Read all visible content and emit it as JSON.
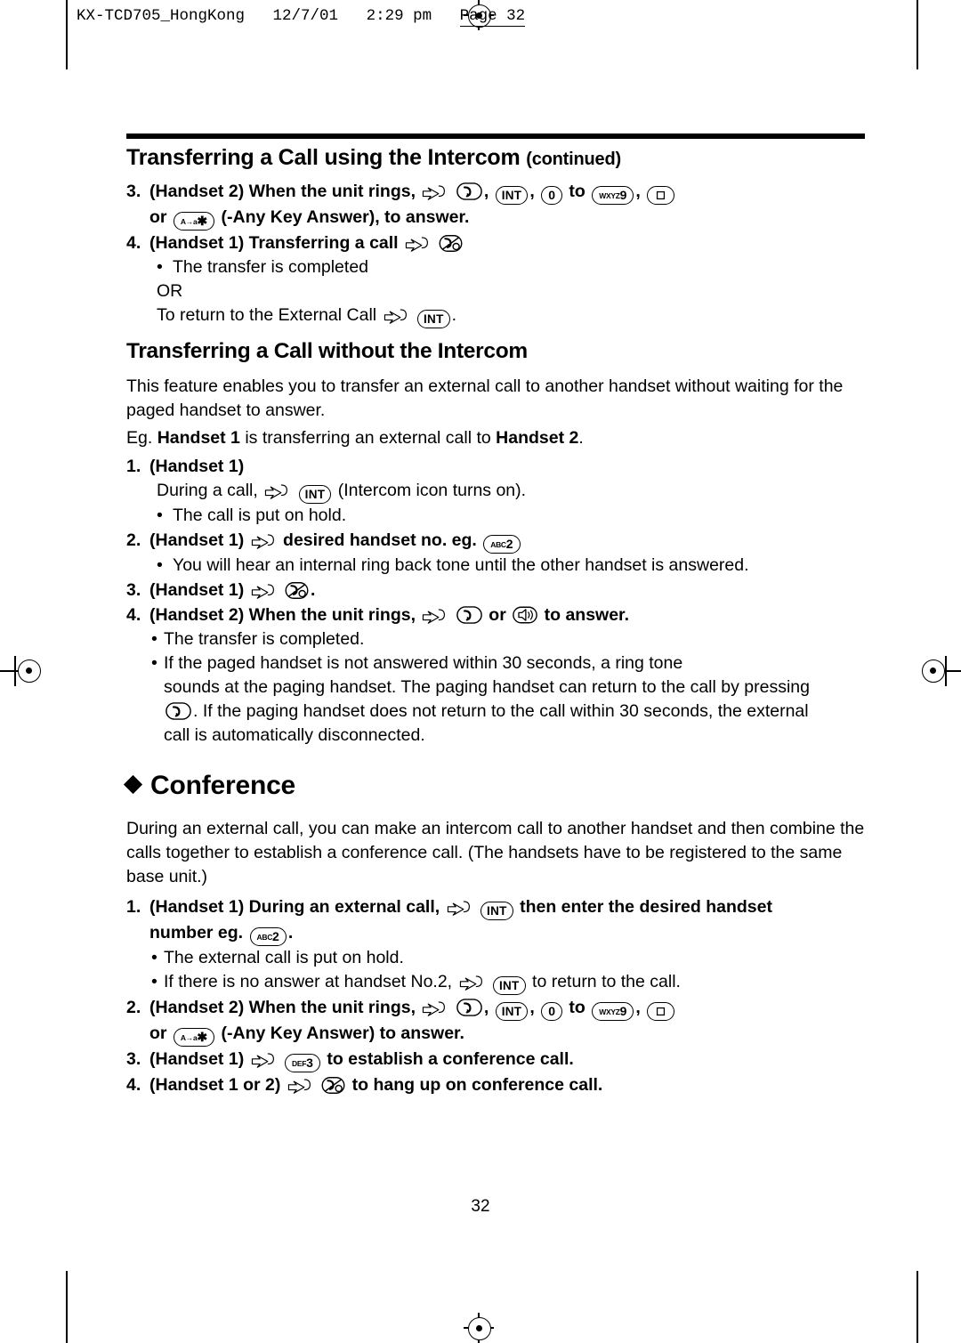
{
  "slug": {
    "file": "KX-TCD705_HongKong",
    "date": "12/7/01",
    "time": "2:29 pm",
    "page_label": "Page 32"
  },
  "page_number": "32",
  "section": {
    "title": "Transferring a Call using the Intercom",
    "title_suffix": "(continued)",
    "steps": [
      {
        "num": "3.",
        "text_a": "(Handset 2) When the unit rings,",
        "text_b": ",",
        "text_c": ",",
        "text_d": "to",
        "text_e": ",",
        "text_f": ""
      },
      {
        "num": "",
        "text_a": "or",
        "text_b": "(-Any Key Answer), to answer."
      },
      {
        "num": "4.",
        "text_a": "(Handset 1) Transferring a call"
      }
    ],
    "bullet_transfer_completed": "The transfer is completed",
    "or_text": "OR",
    "return_text_a": "To return to the External Call",
    "return_text_b": "."
  },
  "without_intercom": {
    "title": "Transferring a Call without the Intercom",
    "intro": "This feature enables you to transfer an external call to another handset without waiting for the paged handset to answer.",
    "eg_prefix": "Eg.",
    "eg_bold1": "Handset 1",
    "eg_mid": "is transferring an external call to",
    "eg_bold2": "Handset 2",
    "eg_end": ".",
    "step1_num": "1.",
    "step1_text": "(Handset 1)",
    "step1_detail_a": "During a call,",
    "step1_detail_b": "(Intercom icon turns on).",
    "step1_bullet": "The call is put on hold.",
    "step2_num": "2.",
    "step2_text_a": "(Handset 1)",
    "step2_text_b": "desired handset no. eg.",
    "step2_bullet": "You will hear an internal ring back tone until the other handset is answered.",
    "step3_num": "3.",
    "step3_text": "(Handset 1)",
    "step3_end": ".",
    "step4_num": "4.",
    "step4_text_a": "(Handset 2) When the unit rings,",
    "step4_text_b": "or",
    "step4_text_c": "to answer.",
    "bullet_a": "The transfer is completed.",
    "bullet_b_1": "If the paged handset is not answered within 30 seconds, a ring tone",
    "bullet_b_2": "sounds at the paging handset. The paging handset can return to the call by pressing",
    "bullet_b_3": ". If the paging handset does not return to the call within 30 seconds, the external",
    "bullet_b_4": "call is automatically disconnected."
  },
  "conference": {
    "title": "Conference",
    "intro": "During an external call, you can make an intercom call to another handset and then combine the calls together to establish a conference call. (The handsets have to be registered to the same base unit.)",
    "step1_num": "1.",
    "step1_a": "(Handset 1) During an external call,",
    "step1_b": "then enter the desired handset",
    "step1_c": "number eg.",
    "step1_d": ".",
    "bullet1": "The external call is put on hold.",
    "bullet2_a": "If there is no answer at handset No.2,",
    "bullet2_b": "to return to the call.",
    "step2_num": "2.",
    "step2_a": "(Handset 2) When the unit rings,",
    "step2_b": ",",
    "step2_c": ",",
    "step2_d": "to",
    "step2_e": ",",
    "step2_or_a": "or",
    "step2_or_b": "(-Any Key Answer) to answer.",
    "step3_num": "3.",
    "step3_a": "(Handset 1)",
    "step3_b": "to establish a conference call.",
    "step4_num": "4.",
    "step4_a": "(Handset 1 or 2)",
    "step4_b": "to hang up on conference call."
  },
  "keys": {
    "int": "INT",
    "zero": "0",
    "nine_sup": "WXYZ",
    "nine": "9",
    "two_sup": "ABC",
    "two": "2",
    "three_sup": "DEF",
    "three": "3",
    "star_sup": "A→a",
    "star": "✱"
  }
}
